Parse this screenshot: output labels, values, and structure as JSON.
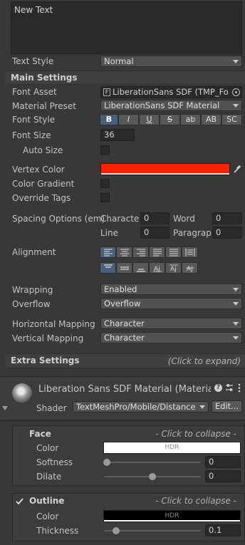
{
  "text_input": {
    "value": "New Text"
  },
  "text_style": {
    "label": "Text Style",
    "value": "Normal"
  },
  "main_settings": {
    "header": "Main Settings",
    "font_asset": {
      "label": "Font Asset",
      "value": "LiberationSans SDF (TMP_Fo"
    },
    "material_preset": {
      "label": "Material Preset",
      "value": "LiberationSans SDF Material"
    },
    "font_style": {
      "label": "Font Style",
      "buttons": [
        "B",
        "I",
        "U",
        "S",
        "ab",
        "AB",
        "SC"
      ]
    },
    "font_size": {
      "label": "Font Size",
      "value": "36"
    },
    "auto_size": {
      "label": "Auto Size"
    },
    "vertex_color": {
      "label": "Vertex Color",
      "color": "#ff2200"
    },
    "color_gradient": {
      "label": "Color Gradient"
    },
    "override_tags": {
      "label": "Override Tags"
    },
    "spacing": {
      "label": "Spacing Options (em)",
      "character_label": "Characte",
      "character_value": "0",
      "word_label": "Word",
      "word_value": "0",
      "line_label": "Line",
      "line_value": "0",
      "paragraph_label": "Paragrapl",
      "paragraph_value": "0"
    },
    "alignment": {
      "label": "Alignment"
    },
    "wrapping": {
      "label": "Wrapping",
      "value": "Enabled"
    },
    "overflow": {
      "label": "Overflow",
      "value": "Overflow"
    },
    "horizontal_mapping": {
      "label": "Horizontal Mapping",
      "value": "Character"
    },
    "vertical_mapping": {
      "label": "Vertical Mapping",
      "value": "Character"
    }
  },
  "extra_settings": {
    "header": "Extra Settings",
    "hint": "(Click to expand)"
  },
  "material": {
    "title": "Liberation Sans SDF Material (Material",
    "shader_label": "Shader",
    "shader_value": "TextMeshPro/Mobile/Distance",
    "edit_label": "Edit..."
  },
  "face": {
    "title": "Face",
    "collapse_hint": "- Click to collapse -",
    "color_label": "Color",
    "color_hdr": "HDR",
    "softness_label": "Softness",
    "softness_value": "0",
    "dilate_label": "Dilate",
    "dilate_value": "0"
  },
  "outline": {
    "title": "Outline",
    "collapse_hint": "- Click to collapse -",
    "color_label": "Color",
    "color_hdr": "HDR",
    "thickness_label": "Thickness",
    "thickness_value": "0.1"
  },
  "colors": {
    "accent": "#46607c",
    "vertex": "#ff2200"
  }
}
